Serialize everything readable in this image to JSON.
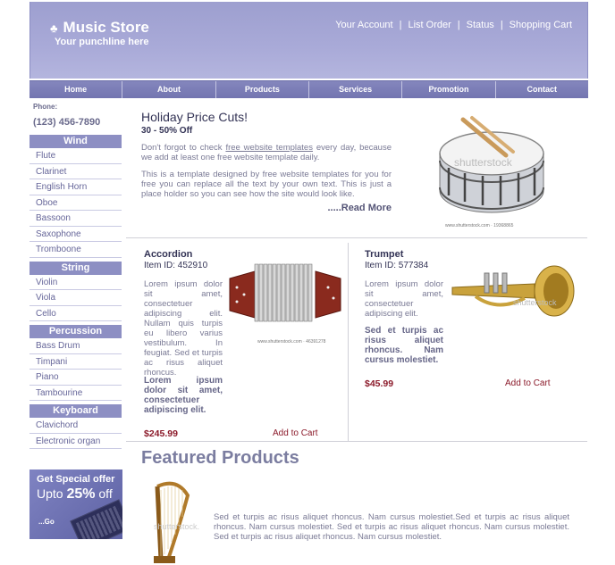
{
  "header": {
    "logo_title": "Music Store",
    "logo_sub": "Your punchline here",
    "links": [
      "Your Account",
      "List Order",
      "Status",
      "Shopping Cart"
    ],
    "separator": "|"
  },
  "nav": [
    "Home",
    "About",
    "Products",
    "Services",
    "Promotion",
    "Contact"
  ],
  "sidebar": {
    "phone_label": "Phone:",
    "phone": "(123) 456-7890",
    "categories": [
      {
        "title": "Wind",
        "items": [
          "Flute",
          "Clarinet",
          "English Horn",
          "Oboe",
          "Bassoon",
          "Saxophone",
          "Tromboone"
        ]
      },
      {
        "title": "String",
        "items": [
          "Violin",
          "Viola",
          "Cello"
        ]
      },
      {
        "title": "Percussion",
        "items": [
          "Bass Drum",
          "Timpani",
          "Piano",
          "Tambourine"
        ]
      },
      {
        "title": "Keyboard",
        "items": [
          "Clavichord",
          "Electronic organ"
        ]
      }
    ],
    "promo": {
      "line1": "Get Special offer",
      "line2_prefix": "Upto ",
      "line2_value": "25%",
      "line2_suffix": " off",
      "go": "...Go"
    }
  },
  "hero": {
    "title": "Holiday Price Cuts!",
    "subtitle": "30 - 50% Off",
    "p1_a": "Don't forgot to check ",
    "p1_link": "free website templates",
    "p1_b": " every day, because we add at least one free website template daily.",
    "p2": "This is a template designed by free website templates for you for free you can replace all the text by your own text. This is just a place holder so you can see how the site would look like.",
    "read_more": ".....Read More",
    "image_caption": "www.shutterstock.com · 19368865",
    "watermark": "shutterstock"
  },
  "products": [
    {
      "name": "Accordion",
      "item_id": "Item ID: 452910",
      "desc": "Lorem ipsum dolor sit amet, consectetuer adipiscing elit. Nullam quis turpis eu libero varius vestibulum. In feugiat. Sed et turpis ac risus aliquet rhoncus.",
      "bold": "Lorem ipsum dolor sit amet, consectetuer adipiscing elit.",
      "price": "$245.99",
      "cart": "Add to Cart",
      "image_caption": "www.shutterstock.com · 46391278"
    },
    {
      "name": "Trumpet",
      "item_id": "Item ID: 577384",
      "desc": "Lorem ipsum dolor sit amet, consectetuer adipiscing elit.",
      "bold": "Sed et turpis ac risus aliquet rhoncus. Nam cursus molestiet.",
      "price": "$45.99",
      "cart": "Add to Cart",
      "watermark": "shutterstock"
    }
  ],
  "featured": {
    "title": "Featured Products",
    "text": "Sed et turpis ac risus aliquet rhoncus. Nam cursus molestiet.Sed et turpis ac risus aliquet rhoncus. Nam cursus molestiet. Sed et turpis ac risus aliquet rhoncus. Nam cursus molestiet. Sed et turpis ac risus aliquet rhoncus. Nam cursus molestiet.",
    "watermark": "shutterstock."
  }
}
